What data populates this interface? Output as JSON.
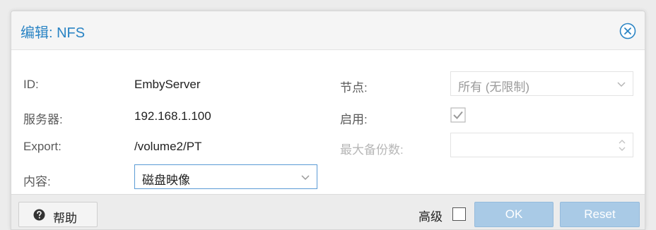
{
  "dialog": {
    "title": "编辑: NFS"
  },
  "form": {
    "left": {
      "id_label": "ID:",
      "id_value": "EmbyServer",
      "server_label": "服务器:",
      "server_value": "192.168.1.100",
      "export_label": "Export:",
      "export_value": "/volume2/PT",
      "content_label": "内容:",
      "content_value": "磁盘映像"
    },
    "right": {
      "nodes_label": "节点:",
      "nodes_value": "所有 (无限制)",
      "enable_label": "启用:",
      "enable_checked": true,
      "max_backups_label": "最大备份数:",
      "max_backups_value": ""
    }
  },
  "footer": {
    "help_label": "帮助",
    "advanced_label": "高级",
    "advanced_checked": false,
    "ok_label": "OK",
    "reset_label": "Reset"
  },
  "colors": {
    "title": "#2a84c4",
    "primary_button": "#a9cae6",
    "active_border": "#5b9bd5"
  }
}
